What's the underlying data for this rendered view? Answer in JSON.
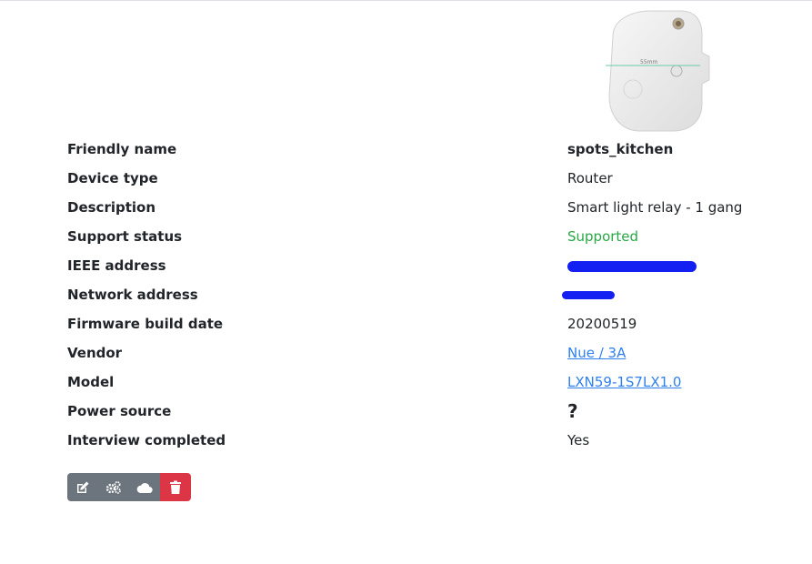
{
  "device": {
    "image_alt": "Device image",
    "image_dimension_label": "55mm"
  },
  "fields": [
    {
      "label": "Friendly name",
      "value": "spots_kitchen"
    },
    {
      "label": "Device type",
      "value": "Router"
    },
    {
      "label": "Description",
      "value": "Smart light relay - 1 gang"
    },
    {
      "label": "Support status",
      "value": "Supported"
    },
    {
      "label": "IEEE address",
      "value": ""
    },
    {
      "label": "Network address",
      "value": ""
    },
    {
      "label": "Firmware build date",
      "value": "20200519"
    },
    {
      "label": "Vendor",
      "value": "Nue / 3A"
    },
    {
      "label": "Model",
      "value": "LXN59-1S7LX1.0"
    },
    {
      "label": "Power source",
      "value": "?"
    },
    {
      "label": "Interview completed",
      "value": "Yes"
    }
  ],
  "colors": {
    "supported": "#28a745",
    "link": "#2f80ed",
    "button_secondary": "#6c757d",
    "button_danger": "#dc3545",
    "redaction": "#1420f2"
  },
  "actions": {
    "icons": [
      "edit-icon",
      "cogs-icon",
      "cloud-icon",
      "trash-icon"
    ]
  }
}
